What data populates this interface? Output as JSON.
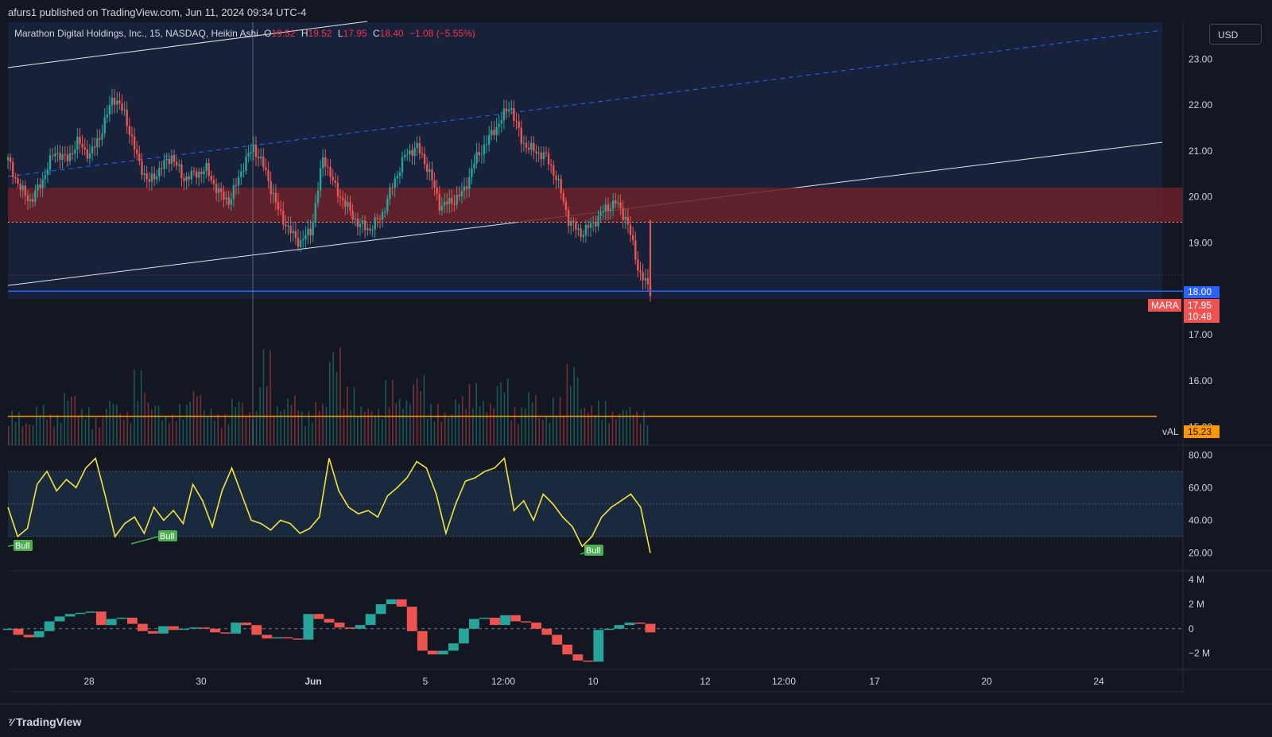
{
  "header": {
    "published": "afurs1 published on TradingView.com, Jun 11, 2024 09:34 UTC-4"
  },
  "legend": {
    "name": "Marathon Digital Holdings, Inc., 15, NASDAQ, Heikin Ashi",
    "o_label": "O",
    "o": "19.52",
    "h_label": "H",
    "h": "19.52",
    "l_label": "L",
    "l": "17.95",
    "c_label": "C",
    "c": "18.40",
    "change": "−1.08 (−5.55%)"
  },
  "currency_button": "USD",
  "footer": {
    "logo_text": "TradingView"
  },
  "colors": {
    "background": "#131722",
    "up": "#26a69a",
    "down": "#ef5350",
    "rsi": "#f5e23b",
    "val": "#ff9800",
    "blue": "#2962ff",
    "zone": "#6b2028",
    "channel": "#1b2a4e"
  },
  "chart_data": {
    "type": "candlestick",
    "symbol": "MARA",
    "x_ticks": [
      "28",
      "30",
      "Jun",
      "5",
      "12:00",
      "10",
      "12",
      "12:00",
      "17",
      "20",
      "24"
    ],
    "price_axis": {
      "ticks": [
        "23.00",
        "22.00",
        "21.00",
        "20.00",
        "19.00",
        "17.00",
        "16.00",
        "15.00"
      ],
      "ylim": [
        14.6,
        23.8
      ]
    },
    "price_labels": [
      {
        "text": "18.00",
        "value": 18.0,
        "color": "#2962ff"
      },
      {
        "text": "17.95",
        "sub": "10:48",
        "value": 17.95,
        "color": "#ef5350",
        "tag": "MARA"
      },
      {
        "text": "15.23",
        "value": 15.23,
        "color": "#ff9800",
        "tag": "vAL"
      }
    ],
    "close_path": [
      20.8,
      20.2,
      19.9,
      20.4,
      21.0,
      20.8,
      21.2,
      20.9,
      21.4,
      22.2,
      21.8,
      20.9,
      20.3,
      20.6,
      20.9,
      20.4,
      20.5,
      20.6,
      20.1,
      19.9,
      20.6,
      21.1,
      20.6,
      19.8,
      19.3,
      19.0,
      19.3,
      20.9,
      20.2,
      19.8,
      19.4,
      19.3,
      19.6,
      20.3,
      20.9,
      21.1,
      20.6,
      19.8,
      19.9,
      20.1,
      20.8,
      21.2,
      21.6,
      22.0,
      21.2,
      21.0,
      20.9,
      20.4,
      19.5,
      19.2,
      19.4,
      19.7,
      19.9,
      19.5,
      18.4,
      17.95
    ],
    "resistance_zone": [
      19.45,
      20.2
    ],
    "dotted_level": 19.45,
    "dotted_level_2": 18.3,
    "volume": [
      1.0,
      0.7,
      1.2,
      0.9,
      1.6,
      1.1,
      0.8,
      1.4,
      1.0,
      2.2,
      1.3,
      0.9,
      1.2,
      1.7,
      1.1,
      0.9,
      1.4,
      1.0,
      2.8,
      1.2,
      1.5,
      1.0,
      1.3,
      2.9,
      1.7,
      1.2,
      1.1,
      1.9,
      1.4,
      2.1,
      1.2,
      1.0,
      1.5,
      1.8,
      1.3,
      2.0,
      1.1,
      1.6,
      0.9,
      1.4,
      2.4,
      1.2,
      1.3,
      1.0,
      1.2,
      1.0
    ],
    "rsi": {
      "ticks": [
        "80.00",
        "60.00",
        "40.00",
        "20.00"
      ],
      "ylim": [
        10,
        85
      ],
      "bands": [
        30,
        50,
        70
      ],
      "values": [
        48,
        30,
        35,
        62,
        70,
        58,
        65,
        60,
        72,
        78,
        55,
        30,
        38,
        42,
        32,
        48,
        40,
        46,
        38,
        62,
        52,
        36,
        58,
        72,
        56,
        40,
        38,
        34,
        40,
        38,
        32,
        35,
        42,
        78,
        58,
        48,
        44,
        46,
        42,
        55,
        60,
        66,
        76,
        72,
        56,
        32,
        50,
        64,
        66,
        70,
        72,
        78,
        46,
        52,
        40,
        56,
        50,
        42,
        36,
        24,
        30,
        42,
        48,
        52,
        56,
        48,
        20
      ],
      "labels": [
        "Bull",
        "Bull",
        "Bull"
      ]
    },
    "oscillator": {
      "ticks": [
        "4 M",
        "2 M",
        "0",
        "−2 M"
      ],
      "ylim": [
        -3.2,
        4.6
      ],
      "values": [
        0.0,
        -0.5,
        -0.7,
        -0.2,
        0.6,
        1.0,
        1.2,
        1.3,
        1.4,
        0.3,
        0.8,
        0.9,
        0.4,
        -0.2,
        -0.4,
        0.2,
        -0.1,
        0.0,
        0.1,
        0.0,
        -0.3,
        -0.4,
        0.5,
        0.3,
        -0.5,
        -0.8,
        -0.7,
        -0.8,
        -0.9,
        1.2,
        0.8,
        0.5,
        0.1,
        0.0,
        0.3,
        1.2,
        2.0,
        2.4,
        1.8,
        -0.2,
        -1.8,
        -2.1,
        -1.8,
        -1.2,
        0.0,
        0.8,
        0.9,
        0.3,
        1.1,
        0.6,
        0.5,
        0.0,
        -0.5,
        -1.3,
        -2.1,
        -2.6,
        -2.7,
        -0.1,
        0.0,
        0.3,
        0.5,
        0.4,
        -0.3
      ]
    }
  }
}
